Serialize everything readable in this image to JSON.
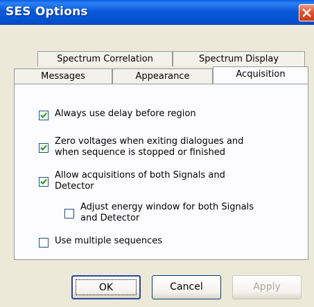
{
  "window": {
    "title": "SES Options"
  },
  "tabs": {
    "row_back": [
      "Spectrum Correlation",
      "Spectrum Display"
    ],
    "row_front": [
      "Messages",
      "Appearance",
      "Acquisition"
    ],
    "active": "Acquisition"
  },
  "options": [
    {
      "label_lines": [
        "Always use delay before region"
      ],
      "checked": true
    },
    {
      "label_lines": [
        "Zero voltages when exiting dialogues and",
        "when sequence is stopped or finished"
      ],
      "checked": true
    },
    {
      "label_lines": [
        "Allow acquisitions of both Signals and",
        "Detector"
      ],
      "checked": true
    },
    {
      "label_lines": [
        "Adjust energy window for both Signals",
        "and Detector"
      ],
      "checked": false
    },
    {
      "label_lines": [
        "Use multiple sequences"
      ],
      "checked": false
    }
  ],
  "buttons": {
    "ok": "OK",
    "cancel": "Cancel",
    "apply": "Apply"
  }
}
